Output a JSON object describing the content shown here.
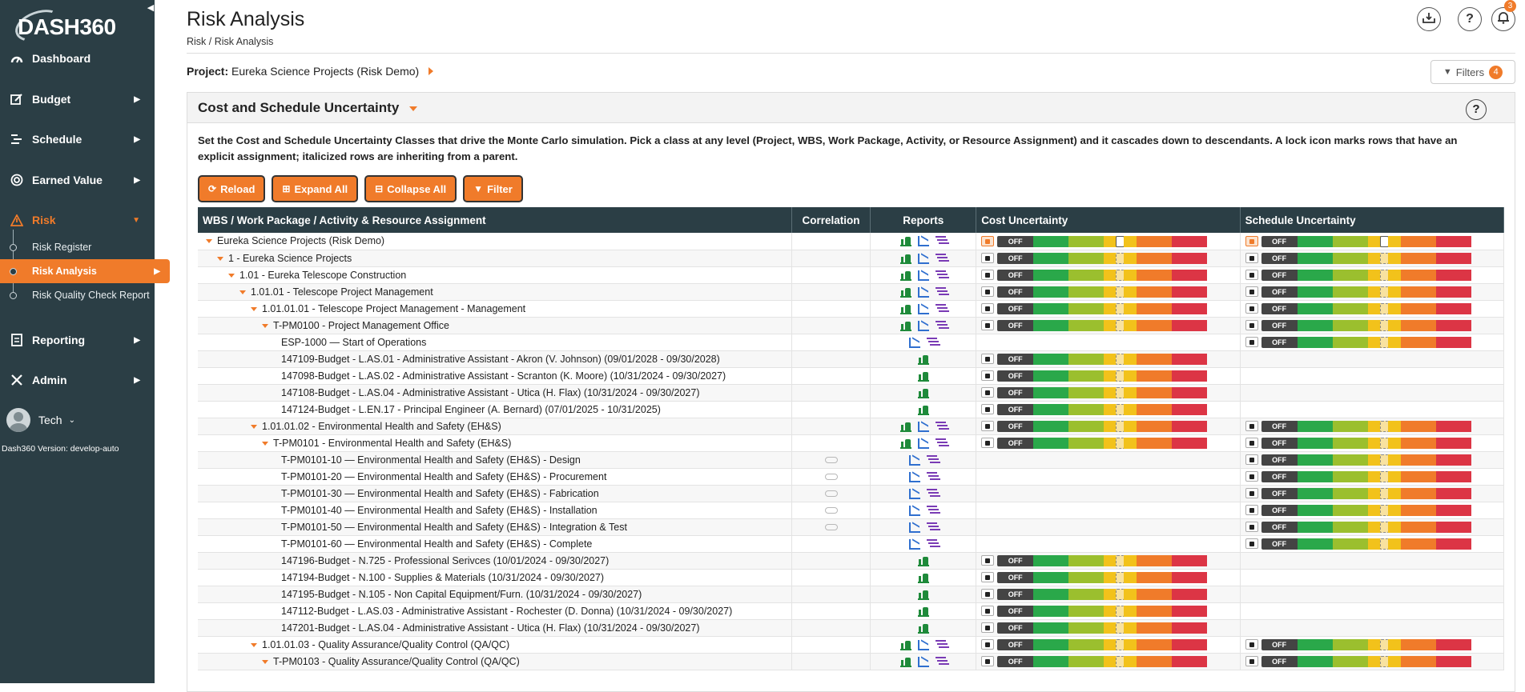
{
  "sidebar": {
    "logo": "DASH360",
    "nav": [
      {
        "label": "Dashboard",
        "icon": "gauge-icon"
      },
      {
        "label": "Budget",
        "icon": "edit-icon"
      },
      {
        "label": "Schedule",
        "icon": "schedule-icon"
      },
      {
        "label": "Earned Value",
        "icon": "target-icon"
      },
      {
        "label": "Risk",
        "icon": "warning-icon"
      }
    ],
    "risk_sub": [
      {
        "label": "Risk Register"
      },
      {
        "label": "Risk Analysis"
      },
      {
        "label": "Risk Quality Check Report"
      }
    ],
    "nav2": [
      {
        "label": "Reporting",
        "icon": "report-icon"
      },
      {
        "label": "Admin",
        "icon": "tools-icon"
      }
    ],
    "user": "Tech",
    "version": "Dash360 Version: develop-auto"
  },
  "header": {
    "title": "Risk Analysis",
    "breadcrumb": "Risk  /  Risk Analysis",
    "project_label": "Project:",
    "project_name": "Eureka Science Projects (Risk Demo)",
    "filters_label": "Filters",
    "filters_count": "4",
    "notif_count": "3"
  },
  "card": {
    "title": "Cost and Schedule Uncertainty",
    "description": "Set the Cost and Schedule Uncertainty Classes that drive the Monte Carlo simulation. Pick a class at any level (Project, WBS, Work Package, Activity, or Resource Assignment) and it cascades down to descendants. A lock icon marks rows that have an explicit assignment; italicized rows are inheriting from a parent.",
    "buttons": {
      "reload": "Reload",
      "expand": "Expand All",
      "collapse": "Collapse All",
      "filter": "Filter"
    }
  },
  "table": {
    "headers": {
      "name": "WBS / Work Package / Activity & Resource Assignment",
      "correlation": "Correlation",
      "reports": "Reports",
      "cost": "Cost Uncertainty",
      "schedule": "Schedule Uncertainty"
    },
    "off_label": "OFF",
    "colors": {
      "off": "#444444",
      "green": "#2aa84a",
      "lime": "#9bbf2e",
      "yellow": "#f2c21b",
      "orange": "#f07b2a",
      "red": "#dc3545"
    },
    "rows": [
      {
        "name": "Eureka Science Projects (Risk Demo)",
        "level": 0,
        "caret": true,
        "corr": false,
        "rep": "mcs",
        "cost": "explicit",
        "sched": "explicit"
      },
      {
        "name": "1 - Eureka Science Projects",
        "level": 1,
        "caret": true,
        "corr": false,
        "rep": "mcs",
        "cost": "inherit",
        "sched": "inherit"
      },
      {
        "name": "1.01 - Eureka Telescope Construction",
        "level": 2,
        "caret": true,
        "corr": false,
        "rep": "mcs",
        "cost": "inherit",
        "sched": "inherit"
      },
      {
        "name": "1.01.01 - Telescope Project Management",
        "level": 3,
        "caret": true,
        "corr": false,
        "rep": "mcs",
        "cost": "inherit",
        "sched": "inherit"
      },
      {
        "name": "1.01.01.01 - Telescope Project Management - Management",
        "level": 4,
        "caret": true,
        "corr": false,
        "rep": "mcs",
        "cost": "inherit",
        "sched": "inherit"
      },
      {
        "name": "T-PM0100 - Project Management Office",
        "level": 5,
        "caret": true,
        "corr": false,
        "rep": "mcs",
        "cost": "inherit",
        "sched": "inherit"
      },
      {
        "name": "ESP-1000 — Start of Operations",
        "level": 6,
        "caret": false,
        "corr": false,
        "rep": "cs",
        "cost": "",
        "sched": "inherit"
      },
      {
        "name": "147109-Budget - L.AS.01 - Administrative Assistant - Akron (V. Johnson) (09/01/2028 - 09/30/2028)",
        "level": 6,
        "caret": false,
        "corr": false,
        "rep": "m",
        "cost": "inherit",
        "sched": ""
      },
      {
        "name": "147098-Budget - L.AS.02 - Administrative Assistant - Scranton (K. Moore) (10/31/2024 - 09/30/2027)",
        "level": 6,
        "caret": false,
        "corr": false,
        "rep": "m",
        "cost": "inherit",
        "sched": ""
      },
      {
        "name": "147108-Budget - L.AS.04 - Administrative Assistant - Utica (H. Flax) (10/31/2024 - 09/30/2027)",
        "level": 6,
        "caret": false,
        "corr": false,
        "rep": "m",
        "cost": "inherit",
        "sched": ""
      },
      {
        "name": "147124-Budget - L.EN.17 - Principal Engineer (A. Bernard) (07/01/2025 - 10/31/2025)",
        "level": 6,
        "caret": false,
        "corr": false,
        "rep": "m",
        "cost": "inherit",
        "sched": ""
      },
      {
        "name": "1.01.01.02 - Environmental Health and Safety (EH&S)",
        "level": 4,
        "caret": true,
        "corr": false,
        "rep": "mcs",
        "cost": "inherit",
        "sched": "inherit"
      },
      {
        "name": "T-PM0101 - Environmental Health and Safety (EH&S)",
        "level": 5,
        "caret": true,
        "corr": false,
        "rep": "mcs",
        "cost": "inherit",
        "sched": "inherit"
      },
      {
        "name": "T-PM0101-10 — Environmental Health and Safety (EH&S) - Design",
        "level": 6,
        "caret": false,
        "corr": true,
        "rep": "cs",
        "cost": "",
        "sched": "inherit"
      },
      {
        "name": "T-PM0101-20 — Environmental Health and Safety (EH&S) - Procurement",
        "level": 6,
        "caret": false,
        "corr": true,
        "rep": "cs",
        "cost": "",
        "sched": "inherit"
      },
      {
        "name": "T-PM0101-30 — Environmental Health and Safety (EH&S) - Fabrication",
        "level": 6,
        "caret": false,
        "corr": true,
        "rep": "cs",
        "cost": "",
        "sched": "inherit"
      },
      {
        "name": "T-PM0101-40 — Environmental Health and Safety (EH&S) - Installation",
        "level": 6,
        "caret": false,
        "corr": true,
        "rep": "cs",
        "cost": "",
        "sched": "inherit"
      },
      {
        "name": "T-PM0101-50 — Environmental Health and Safety (EH&S) - Integration & Test",
        "level": 6,
        "caret": false,
        "corr": true,
        "rep": "cs",
        "cost": "",
        "sched": "inherit"
      },
      {
        "name": "T-PM0101-60 — Environmental Health and Safety (EH&S) - Complete",
        "level": 6,
        "caret": false,
        "corr": false,
        "rep": "cs",
        "cost": "",
        "sched": "inherit"
      },
      {
        "name": "147196-Budget - N.725 - Professional Serivces (10/01/2024 - 09/30/2027)",
        "level": 6,
        "caret": false,
        "corr": false,
        "rep": "m",
        "cost": "inherit",
        "sched": ""
      },
      {
        "name": "147194-Budget - N.100 - Supplies & Materials (10/31/2024 - 09/30/2027)",
        "level": 6,
        "caret": false,
        "corr": false,
        "rep": "m",
        "cost": "inherit",
        "sched": ""
      },
      {
        "name": "147195-Budget - N.105 - Non Capital Equipment/Furn. (10/31/2024 - 09/30/2027)",
        "level": 6,
        "caret": false,
        "corr": false,
        "rep": "m",
        "cost": "inherit",
        "sched": ""
      },
      {
        "name": "147112-Budget - L.AS.03 - Administrative Assistant - Rochester (D. Donna) (10/31/2024 - 09/30/2027)",
        "level": 6,
        "caret": false,
        "corr": false,
        "rep": "m",
        "cost": "inherit",
        "sched": ""
      },
      {
        "name": "147201-Budget - L.AS.04 - Administrative Assistant - Utica (H. Flax) (10/31/2024 - 09/30/2027)",
        "level": 6,
        "caret": false,
        "corr": false,
        "rep": "m",
        "cost": "inherit",
        "sched": ""
      },
      {
        "name": "1.01.01.03 - Quality Assurance/Quality Control (QA/QC)",
        "level": 4,
        "caret": true,
        "corr": false,
        "rep": "mcs",
        "cost": "inherit",
        "sched": "inherit"
      },
      {
        "name": "T-PM0103 - Quality Assurance/Quality Control (QA/QC)",
        "level": 5,
        "caret": true,
        "corr": false,
        "rep": "mcs",
        "cost": "inherit",
        "sched": "inherit"
      }
    ]
  }
}
